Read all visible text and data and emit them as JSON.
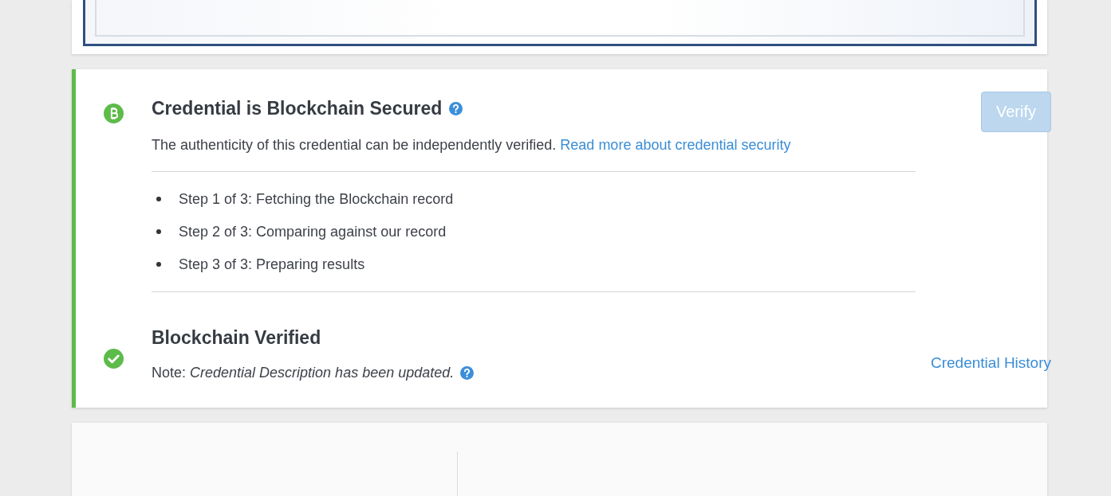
{
  "status": {
    "title": "Credential is Blockchain Secured",
    "description": "The authenticity of this credential can be independently verified.",
    "link": "Read more about credential security",
    "verify_button": {
      "label": "Verify",
      "disabled": true
    },
    "steps": [
      "Step 1 of 3: Fetching the Blockchain record",
      "Step 2 of 3: Comparing against our record",
      "Step 3 of 3: Preparing results"
    ]
  },
  "result": {
    "title": "Blockchain Verified",
    "note": "Note: *Credential Description has been updated.*",
    "history_link": "Credential History"
  }
}
